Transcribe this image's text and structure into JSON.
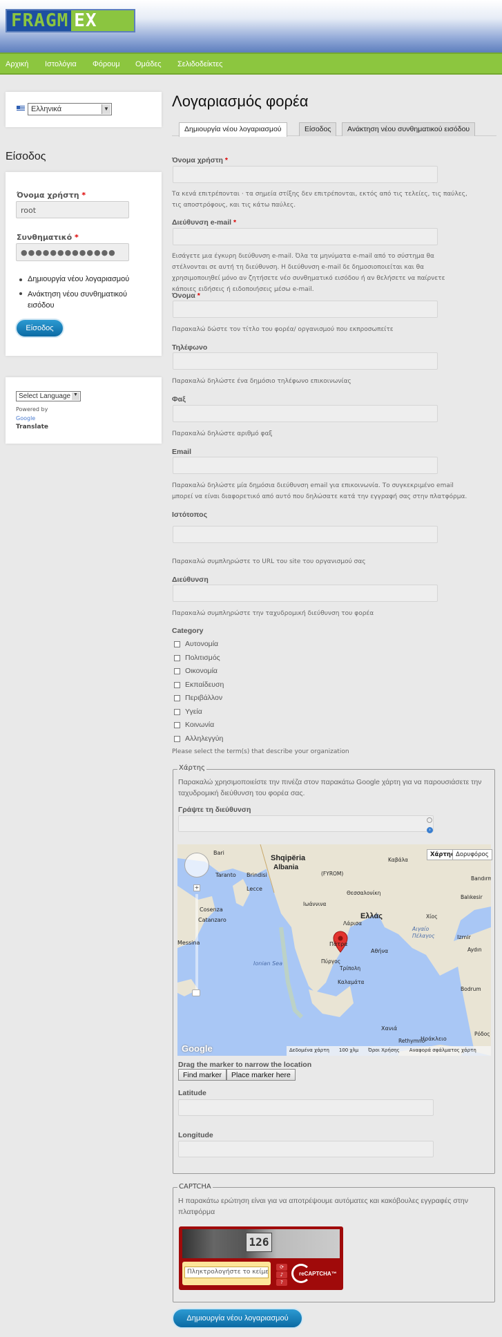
{
  "site": {
    "logo_left": "FRAGM",
    "logo_right": "EX"
  },
  "nav": [
    "Αρχική",
    "Ιστολόγια",
    "Φόρουμ",
    "Ομάδες",
    "Σελιδοδείκτες"
  ],
  "sidebar": {
    "language": "Ελληνικά",
    "login_title": "Είσοδος",
    "username_label": "Όνομα χρήστη",
    "username_value": "root",
    "password_label": "Συνθηματικό",
    "password_value": "●●●●●●●●●●●●●",
    "links": [
      "Δημιουργία νέου λογαριασμού",
      "Ανάκτηση νέου συνθηματικού εισόδου"
    ],
    "login_button": "Είσοδος",
    "translate_select": "Select Language",
    "powered_by": "Powered by",
    "google": "Google",
    "translate": "Translate"
  },
  "main": {
    "title": "Λογαριασμός φορέα",
    "tabs": [
      "Δημιουργία νέου λογαριασμού",
      "Είσοδος",
      "Ανάκτηση νέου συνθηματικού εισόδου"
    ],
    "fields": [
      {
        "label": "Όνομα χρήστη",
        "required": "*",
        "desc": "Τα κενά επιτρέπονται · τα σημεία στίξης δεν επιτρέπονται, εκτός από τις τελείες, τις παύλες, τις αποστρόφους, και τις κάτω παύλες."
      },
      {
        "label": "Διεύθυνση e-mail",
        "required": "*",
        "desc": "Εισάγετε μια έγκυρη διεύθυνση e-mail. Όλα τα μηνύματα e-mail από το σύστημα θα στέλνονται σε αυτή τη διεύθυνση. Η διεύθυνση e-mail δε δημοσιοποιείται και θα χρησιμοποιηθεί μόνο αν ζητήσετε νέο συνθηματικό εισόδου ή αν θελήσετε να παίρνετε κάποιες ειδήσεις ή ειδοποιήσεις μέσω e-mail."
      },
      {
        "label": "Όνομα",
        "required": "*",
        "desc": "Παρακαλώ δώστε τον τίτλο του φορέα/ οργανισμού που εκπροσωπείτε"
      },
      {
        "label": "Τηλέφωνο",
        "desc": "Παρακαλώ δηλώστε ένα δημόσιο τηλέφωνο επικοινωνίας"
      },
      {
        "label": "Φαξ",
        "desc": "Παρακαλώ δηλώστε αριθμό φαξ"
      },
      {
        "label": "Email",
        "desc": "Παρακαλώ δηλώστε μία δημόσια διεύθυνση email για επικοινωνία. Το συγκεκριμένο email μπορεί να είναι διαφορετικό από αυτό που δηλώσατε κατά την εγγραφή σας στην πλατφόρμα."
      },
      {
        "label": "Ιστότοπος",
        "desc": "Παρακαλώ συμπληρώστε το URL του site του οργανισμού σας"
      },
      {
        "label": "Διεύθυνση",
        "desc": "Παρακαλώ συμπληρώστε την ταχυδρομική διεύθυνση του φορέα"
      }
    ],
    "category_label": "Category",
    "categories": [
      "Αυτονομία",
      "Πολιτισμός",
      "Οικονομία",
      "Εκπαίδευση",
      "Περιβάλλον",
      "Υγεία",
      "Κοινωνία",
      "Αλληλεγγύη"
    ],
    "category_desc": "Please select the term(s) that describe your organization",
    "map_legend": "Χάρτης",
    "map_desc": "Παρακαλώ χρησιμοποιείστε την πινέζα στον παρακάτω Google χάρτη για να παρουσιάσετε την ταχυδρομική διεύθυνση του φορέα σας.",
    "address_label": "Γράψτε τη διεύθυνση",
    "map_type_map": "Χάρτης",
    "map_type_sat": "Δορυφόρος",
    "map_labels": [
      "Shqipëria",
      "Albania",
      "Ελλάς",
      "Bari",
      "Taranto",
      "Brindisi",
      "Lecce",
      "Cosenza",
      "Catanzaro",
      "Messina",
      "Ionian Sea",
      "Πάτρα",
      "Αθήνα",
      "Αιγαίο Πέλαγος",
      "Izmir",
      "Χανιά",
      "Ηράκλειο",
      "Λάρισα",
      "Θεσσαλονίκη",
      "Ιωάννινα",
      "Πύργος",
      "Τρίπολη",
      "Καλαμάτα",
      "Ρόδος",
      "Χίος",
      "Rethymno",
      "Bodrum",
      "Aydın",
      "Balıkesir",
      "Bandırma",
      "(FYROM)",
      "Καβάλα"
    ],
    "map_footer": [
      "Δεδομένα χάρτη",
      "100 χλμ",
      "Όροι Χρήσης",
      "Αναφορά σφάλματος χάρτη"
    ],
    "google_logo": "Google",
    "drag_text": "Drag the marker to narrow the location",
    "find_marker": "Find marker",
    "place_marker": "Place marker here",
    "latitude": "Latitude",
    "longitude": "Longitude",
    "captcha_legend": "CAPTCHA",
    "captcha_desc": "Η παρακάτω ερώτηση είναι για να αποτρέψουμε αυτόματες και κακόβουλες εγγραφές στην πλατφόρμα",
    "captcha_code": "126",
    "captcha_placeholder": "Πληκτρολογήστε το κείμενο",
    "recaptcha": "reCAPTCHA™",
    "submit": "Δημιουργία νέου λογαριασμού"
  }
}
